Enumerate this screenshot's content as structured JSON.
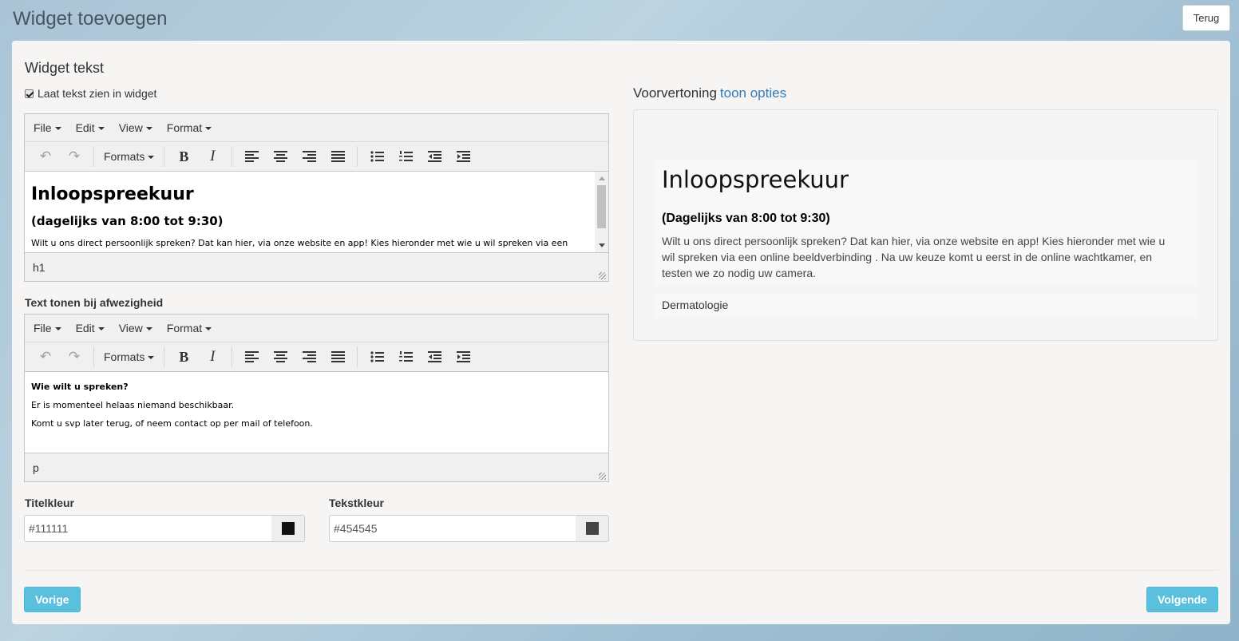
{
  "header": {
    "title": "Widget toevoegen",
    "back_label": "Terug"
  },
  "form": {
    "section_title": "Widget tekst",
    "show_text_label": "Laat tekst zien in widget",
    "show_text_checked": true
  },
  "editor_menus": [
    "File",
    "Edit",
    "View",
    "Format"
  ],
  "editor_toolbar": {
    "formats_label": "Formats"
  },
  "editor1": {
    "heading": "Inloopspreekuur",
    "subheading": "(dagelijks van 8:00 tot 9:30)",
    "body": "Wilt u ons direct persoonlijk spreken? Dat kan hier, via onze website en app! Kies hieronder met wie u wil spreken via een",
    "status": "h1"
  },
  "absence": {
    "label": "Text tonen bij afwezigheid",
    "heading": "Wie wilt u spreken?",
    "line1": "Er is momenteel helaas niemand beschikbaar.",
    "line2": "Komt u svp later terug, of neem contact op per mail of telefoon.",
    "status": "p"
  },
  "colors": {
    "title_label": "Titelkleur",
    "title_value": "#111111",
    "text_label": "Tekstkleur",
    "text_value": "#454545"
  },
  "preview": {
    "label": "Voorvertoning",
    "options_link": "toon opties",
    "title": "Inloopspreekuur",
    "subtitle": "(Dagelijks van 8:00 tot 9:30)",
    "body": "Wilt u ons direct persoonlijk spreken? Dat kan hier, via onze website en app! Kies hieronder met wie u wil spreken via een online beeldverbinding . Na uw keuze komt u eerst in de online wachtkamer, en testen we zo nodig uw camera.",
    "department": "Dermatologie"
  },
  "nav": {
    "prev_label": "Vorige",
    "next_label": "Volgende"
  }
}
